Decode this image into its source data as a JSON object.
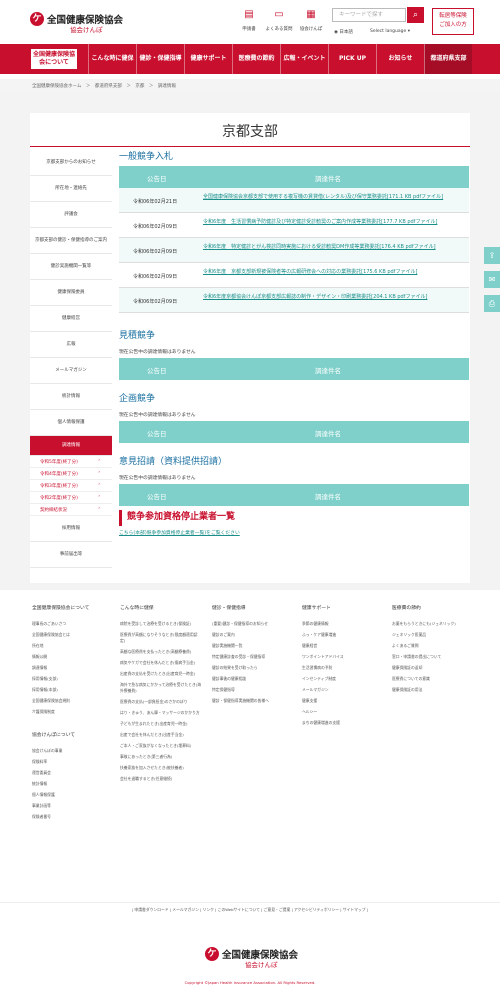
{
  "header": {
    "logo_line1": "全国健康保険協会",
    "logo_line2": "協会けんぽ",
    "utils": [
      {
        "label": "申請書",
        "icon": "document-icon"
      },
      {
        "label": "よくある質問",
        "icon": "question-icon"
      },
      {
        "label": "協会けんぽ",
        "icon": "building-icon"
      }
    ],
    "search_placeholder": "キーワードで探す",
    "lang_ja": "日本語",
    "lang_select": "Select language",
    "consult_line1": "転居等保険",
    "consult_line2": "ご加入の方"
  },
  "nav": [
    {
      "label": "全国健康保険協会について"
    },
    {
      "label": "こんな時に健保"
    },
    {
      "label": "健診・保健指導"
    },
    {
      "label": "健康サポート"
    },
    {
      "label": "医療費の節約"
    },
    {
      "label": "広報・イベント"
    },
    {
      "label": "PICK UP"
    },
    {
      "label": "お知らせ"
    },
    {
      "label": "都道府県支部"
    }
  ],
  "breadcrumb": "全国健康保険協会ホーム　＞　都道府県支部　＞　京都　＞　調達情報",
  "page_title": "京都支部",
  "sidebar": {
    "items": [
      "京都支部からのお知らせ",
      "所在地・連絡先",
      "評議会",
      "京都支部の健診・保健指導のご案内",
      "健診実施機関一覧等",
      "健康保険委員",
      "健康経営",
      "広報",
      "メールマガジン",
      "統計情報",
      "個人情報保護"
    ],
    "active": "調達情報",
    "subs": [
      "令和5年度(終了分)",
      "令和4年度(終了分)",
      "令和3年度(終了分)",
      "令和2年度(終了分)",
      "契約締結状況"
    ],
    "after": [
      "採用情報",
      "事前届出等"
    ]
  },
  "sections": {
    "general_title": "一般競争入札",
    "col_date": "公告日",
    "col_name": "調達件名",
    "rows": [
      {
        "date": "令和06年02月21日",
        "title": "全国健康保険協会京都支部で使用する複写機の賃貸借(レンタル)及び保守業務委託[171.1 KB pdfファイル]"
      },
      {
        "date": "令和06年02月09日",
        "title": "令和6年度　生活習慣病予防健診及び特定健診受診勧奨のご案内作成等業務委託[177.7 KB pdfファイル]"
      },
      {
        "date": "令和06年02月09日",
        "title": "令和6年度　特定健診とがん検診同時実施における受診勧奨DM作成等業務委託[176.4 KB pdfファイル]"
      },
      {
        "date": "令和06年02月09日",
        "title": "令和6年度　京都支部新規被保険者等の広報研修会への対応の業務委託[175.6 KB pdfファイル]"
      },
      {
        "date": "令和06年02月09日",
        "title": "令和6年度京都協会けんぽ京都支部広報誌の制作・デザイン・印刷業務委託[204.1 KB pdfファイル]"
      }
    ],
    "quote_title": "見積競争",
    "none_text": "現在公告中の調達情報はありません",
    "plan_title": "企画競争",
    "opinion_title": "意見招請（資料提供招請）",
    "stop_title": "競争参加資格停止業者一覧",
    "stop_link": "こちら(本部)競争参加資格停止業者一覧)をご覧ください"
  },
  "footer": {
    "cols": [
      {
        "head": "全国健康保険協会について",
        "links": [
          "理事長のごあいさつ",
          "全国健康保険協会とは",
          "所在地",
          "情報公開",
          "調達情報",
          "採用情報(支部)",
          "採用情報(本部)",
          "全国健康保険協会規則",
          "介護保険制度"
        ]
      },
      {
        "head": "こんな時に健保",
        "links": [
          "病院を受診して治療を受けるとき(保険証)",
          "医療費が高額になりそうなとき(限度額適用認定)",
          "高額な医療費を支払ったとき(高額療養費)",
          "病気やケガで会社を休んだとき(傷病手当金)",
          "出産費の支払を受けたとき(出産育児一時金)",
          "海外で急な病気にかかって治療を受けたとき(海外療養費)",
          "医療費の支払(一部負担金)のさかのぼり",
          "はり・きゅう、あん摩・マッサージのかかり方",
          "子どもが生まれたとき(出産育児一時金)",
          "出産で会社を休んだとき(出産手当金)",
          "ご本人・ご家族がなくなったとき(埋葬料)",
          "事故にあったとき(第三者行為)",
          "扶養家族を加入させたとき(被扶養者)",
          "会社を退職するとき(任意継続)"
        ]
      },
      {
        "head": "健診・保健指導",
        "links": [
          "(重要)健診・保健指導のお知らせ",
          "健診のご案内",
          "健診実施機関一覧",
          "特定健康診査の受診・保健指導",
          "健診の結果を受け取ったら",
          "健診事後の健康相談",
          "特定保健指導",
          "健診・保健指導実施機関の皆様へ"
        ]
      },
      {
        "head": "健康サポート",
        "links": [
          "季節の健康情報",
          "ふっ・ケア健康増進",
          "健康経営",
          "ワンポイントアドバイス",
          "生活習慣病の予防",
          "インセンティブ制度",
          "メールマガジン",
          "健康支援",
          "ヘルシー",
          "まちの健康増進の支援"
        ]
      },
      {
        "head": "医療費の節約",
        "links": [
          "お薬をもらうときにも(ジェネリック)",
          "ジェネリック医薬品",
          "よくあるご質問",
          "窓口・申請書の提出について",
          "健康保険証の返却",
          "医療費についての意識",
          "健康保険証の用法"
        ]
      }
    ],
    "col1_second_head": "協会けんぽについて",
    "col1_second_links": [
      "協会けんぽの事業",
      "保険料率",
      "運営委員会",
      "統計情報",
      "個人情報保護",
      "事業計画等",
      "保険者番号"
    ],
    "bar": "| 申請書ダウンロード | メールマガジン | リンク | このWebサイトについて | ご意見・ご提案 | アクセシビリティポリシー | サイトマップ |",
    "logo_line1": "全国健康保険協会",
    "logo_line2": "協会けんぽ",
    "copyright": "Copyright ©Japan Health Insurance Association. All Rights Reserved."
  },
  "colors": {
    "brand": "#c8102e",
    "teal": "#7fd0ca",
    "link": "#1a8f8a"
  }
}
